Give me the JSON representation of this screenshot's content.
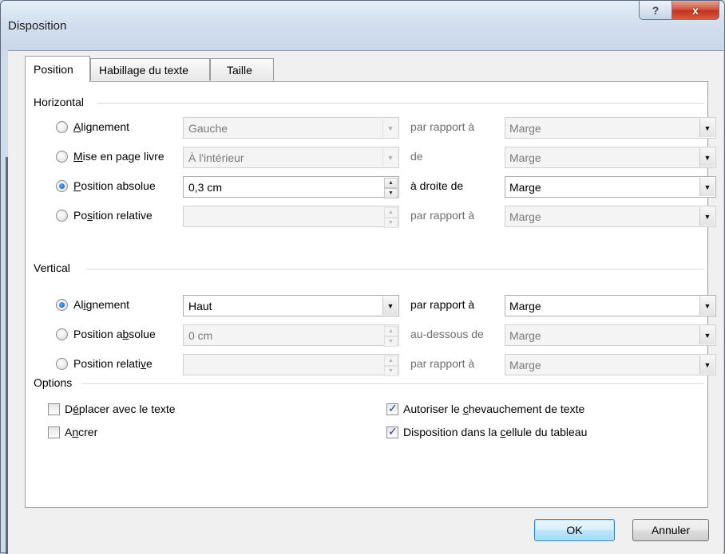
{
  "window": {
    "title": "Disposition",
    "help_glyph": "?",
    "close_glyph": "x"
  },
  "tabs": [
    {
      "label": "Position",
      "active": true
    },
    {
      "label": "Habillage du texte",
      "active": false
    },
    {
      "label": "Taille",
      "active": false
    }
  ],
  "horizontal": {
    "group_label": "Horizontal",
    "rows": [
      {
        "label_pre": "",
        "label_acc": "A",
        "label_post": "lignement",
        "checked": false,
        "field_value": "Gauche",
        "field_kind": "dropdown",
        "enabled": false,
        "rel_label": "par rapport à",
        "rel_value": "Marge"
      },
      {
        "label_pre": "",
        "label_acc": "M",
        "label_post": "ise en page livre",
        "checked": false,
        "field_value": "À l'intérieur",
        "field_kind": "dropdown",
        "enabled": false,
        "rel_label": "de",
        "rel_value": "Marge"
      },
      {
        "label_pre": "",
        "label_acc": "P",
        "label_post": "osition absolue",
        "checked": true,
        "field_value": "0,3 cm",
        "field_kind": "spin",
        "enabled": true,
        "rel_label": "à droite de",
        "rel_value": "Marge"
      },
      {
        "label_pre": "Po",
        "label_acc": "s",
        "label_post": "ition relative",
        "checked": false,
        "field_value": "",
        "field_kind": "spin",
        "enabled": false,
        "rel_label": "par rapport à",
        "rel_value": "Marge"
      }
    ]
  },
  "vertical": {
    "group_label": "Vertical",
    "rows": [
      {
        "label_pre": "Al",
        "label_acc": "i",
        "label_post": "gnement",
        "checked": true,
        "field_value": "Haut",
        "field_kind": "dropdown",
        "enabled": true,
        "rel_label": "par rapport à",
        "rel_value": "Marge"
      },
      {
        "label_pre": "Position a",
        "label_acc": "b",
        "label_post": "solue",
        "checked": false,
        "field_value": "0 cm",
        "field_kind": "spin",
        "enabled": false,
        "rel_label": "au-dessous de",
        "rel_value": "Marge"
      },
      {
        "label_pre": "Position relati",
        "label_acc": "v",
        "label_post": "e",
        "checked": false,
        "field_value": "",
        "field_kind": "spin",
        "enabled": false,
        "rel_label": "par rapport à",
        "rel_value": "Marge"
      }
    ]
  },
  "options": {
    "group_label": "Options",
    "move_with_text": {
      "label": "Déplacer avec le texte",
      "checked": false
    },
    "anchor": {
      "label": "Ancrer",
      "checked": false
    },
    "allow_overlap": {
      "label": "Autoriser le chevauchement de texte",
      "checked": true
    },
    "layout_in_cell": {
      "label": "Disposition dans la cellule du tableau",
      "checked": true
    }
  },
  "buttons": {
    "ok": "OK",
    "cancel": "Annuler"
  },
  "icons": {
    "dropdown": "chevron-down-icon",
    "spin_up": "spin-up-icon",
    "spin_down": "spin-down-icon",
    "check": "check-icon"
  }
}
